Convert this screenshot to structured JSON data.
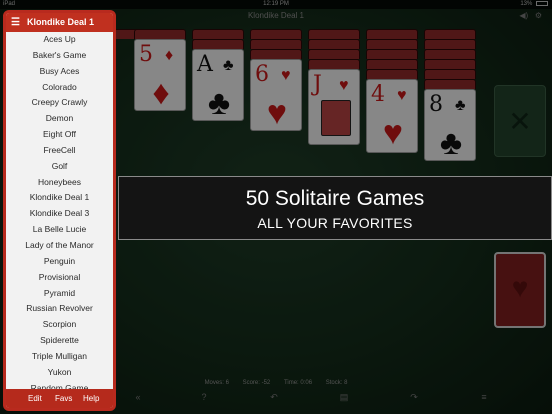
{
  "status_bar": {
    "device": "iPad",
    "time": "12:19 PM",
    "battery": "13%"
  },
  "game_title": "Klondike Deal 1",
  "tableau": {
    "card_5": {
      "rank": "5",
      "suit": "♦"
    },
    "card_A": {
      "rank": "A",
      "suit": "♣"
    },
    "card_6": {
      "rank": "6",
      "suit": "♥"
    },
    "card_J": {
      "rank": "J",
      "suit": "♥"
    },
    "card_4": {
      "rank": "4",
      "suit": "♥"
    },
    "card_8": {
      "rank": "8",
      "suit": "♣"
    }
  },
  "banner": {
    "title": "50 Solitaire Games",
    "subtitle": "ALL YOUR FAVORITES"
  },
  "stats": {
    "moves": "Moves: 6",
    "score": "Score: -52",
    "time": "Time: 0:06",
    "stock": "Stock: 8"
  },
  "menu": {
    "title": "Klondike Deal 1",
    "items": [
      "Aces Up",
      "Baker's Game",
      "Busy Aces",
      "Colorado",
      "Creepy Crawly",
      "Demon",
      "Eight Off",
      "FreeCell",
      "Golf",
      "Honeybees",
      "Klondike Deal 1",
      "Klondike Deal 3",
      "La Belle Lucie",
      "Lady of the Manor",
      "Penguin",
      "Provisional",
      "Pyramid",
      "Russian Revolver",
      "Scorpion",
      "Spiderette",
      "Triple Mulligan",
      "Yukon",
      "Random Game"
    ],
    "footer": {
      "edit": "Edit",
      "favs": "Favs",
      "help": "Help"
    }
  },
  "colors": {
    "menu_accent": "#c0301f",
    "felt": "#1e3a26"
  }
}
